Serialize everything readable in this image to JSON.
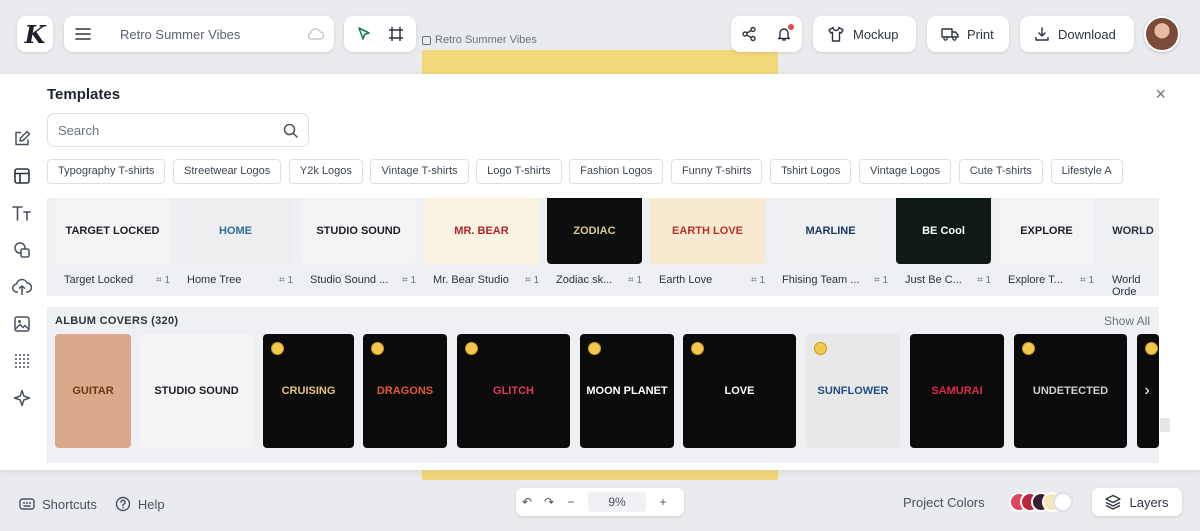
{
  "header": {
    "logo_letter": "K",
    "project_title": "Retro Summer Vibes",
    "breadcrumb": "Retro Summer Vibes",
    "mockup_label": "Mockup",
    "print_label": "Print",
    "download_label": "Download"
  },
  "panel": {
    "title": "Templates",
    "close": "×",
    "search_placeholder": "Search",
    "chips": [
      "Typography T-shirts",
      "Streetwear Logos",
      "Y2k Logos",
      "Vintage T-shirts",
      "Logo T-shirts",
      "Fashion Logos",
      "Funny T-shirts",
      "Tshirt Logos",
      "Vintage Logos",
      "Cute T-shirts",
      "Lifestyle A"
    ],
    "templates": [
      {
        "name": "Target Locked",
        "count": "1",
        "art": "TARGET LOCKED"
      },
      {
        "name": "Home Tree",
        "count": "1",
        "art": "HOME"
      },
      {
        "name": "Studio Sound ...",
        "count": "1",
        "art": "STUDIO SOUND"
      },
      {
        "name": "Mr. Bear Studio",
        "count": "1",
        "art": "MR. BEAR"
      },
      {
        "name": "Zodiac sk...",
        "count": "1",
        "art": "ZODIAC"
      },
      {
        "name": "Earth Love",
        "count": "1",
        "art": "EARTH LOVE"
      },
      {
        "name": "Fhising Team ...",
        "count": "1",
        "art": "MARLINE"
      },
      {
        "name": "Just Be C...",
        "count": "1",
        "art": "BE Cool"
      },
      {
        "name": "Explore T...",
        "count": "1",
        "art": "EXPLORE"
      },
      {
        "name": "World Orde",
        "count": "",
        "art": "WORLD"
      }
    ],
    "album": {
      "title": "ALBUM COVERS (320)",
      "show_all": "Show All",
      "covers": [
        {
          "art": "GUITAR",
          "crown": false
        },
        {
          "art": "STUDIO SOUND",
          "crown": false
        },
        {
          "art": "CRUISING",
          "crown": true
        },
        {
          "art": "DRAGONS",
          "crown": true
        },
        {
          "art": "GLITCH",
          "crown": true
        },
        {
          "art": "MOON PLANET",
          "crown": true
        },
        {
          "art": "LOVE",
          "crown": true
        },
        {
          "art": "SUNFLOWER",
          "crown": true
        },
        {
          "art": "SAMURAI",
          "crown": false
        },
        {
          "art": "UNDETECTED",
          "crown": true
        },
        {
          "art": "",
          "crown": true
        }
      ]
    }
  },
  "footer": {
    "shortcuts": "Shortcuts",
    "help": "Help",
    "zoom": "9%",
    "project_colors": "Project Colors",
    "layers": "Layers"
  },
  "colors": {
    "swatches": [
      "#e0465f",
      "#b8283f",
      "#3b1f2e",
      "#f6e7b5"
    ]
  }
}
